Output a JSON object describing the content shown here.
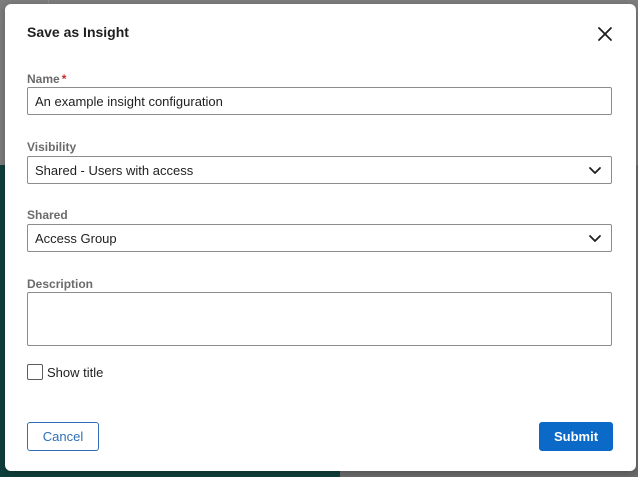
{
  "dialog": {
    "title": "Save as Insight",
    "close_icon": "close-icon"
  },
  "form": {
    "name": {
      "label": "Name",
      "required_marker": "*",
      "value": "An example insight configuration"
    },
    "visibility": {
      "label": "Visibility",
      "selected": "Shared - Users with access"
    },
    "shared": {
      "label": "Shared",
      "selected": "Access Group"
    },
    "description": {
      "label": "Description",
      "value": ""
    },
    "show_title": {
      "label": "Show title",
      "checked": false
    }
  },
  "actions": {
    "cancel_label": "Cancel",
    "submit_label": "Submit"
  },
  "colors": {
    "primary": "#0b69c7",
    "required": "#c62828",
    "backdrop_teal": "#0f3f3b"
  }
}
